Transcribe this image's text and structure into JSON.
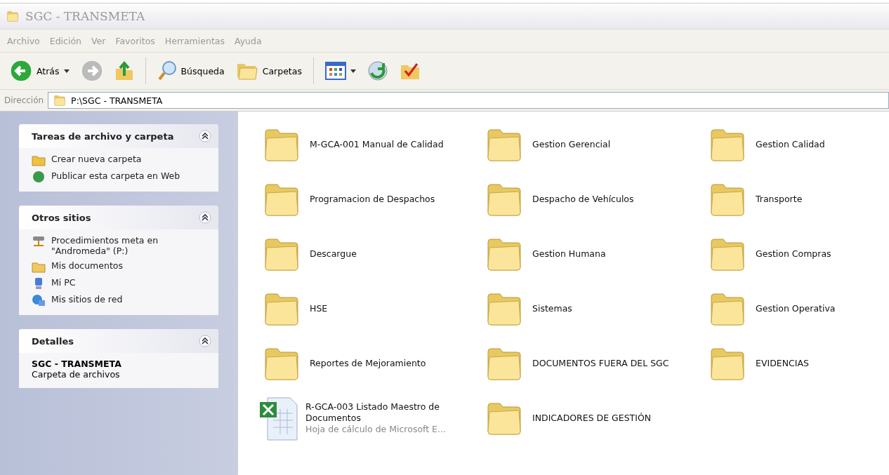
{
  "window": {
    "title": "SGC - TRANSMETA"
  },
  "menu": [
    "Archivo",
    "Edición",
    "Ver",
    "Favoritos",
    "Herramientas",
    "Ayuda"
  ],
  "toolbar": [
    {
      "kind": "back",
      "label": "Atrás"
    },
    {
      "kind": "forward"
    },
    {
      "kind": "up"
    },
    {
      "kind": "separator"
    },
    {
      "kind": "search",
      "label": "Búsqueda"
    },
    {
      "kind": "folders",
      "label": "Carpetas"
    },
    {
      "kind": "separator"
    },
    {
      "kind": "views"
    },
    {
      "kind": "sync"
    },
    {
      "kind": "check"
    }
  ],
  "address": {
    "label": "Dirección",
    "value": "P:\\SGC - TRANSMETA"
  },
  "panels": [
    {
      "title": "Tareas de archivo y carpeta",
      "expanded": true,
      "links": [
        {
          "kind": "newfolder",
          "label": "Crear nueva carpeta"
        },
        {
          "kind": "web",
          "label": "Publicar esta carpeta en Web"
        }
      ]
    },
    {
      "title": "Otros sitios",
      "expanded": true,
      "links": [
        {
          "kind": "drive",
          "label": "Procedimientos meta en \"Andromeda\" (P:)"
        },
        {
          "kind": "docs",
          "label": "Mis documentos"
        },
        {
          "kind": "pc",
          "label": "Mi PC"
        },
        {
          "kind": "network",
          "label": "Mis sitios de red"
        }
      ]
    },
    {
      "title": "Detalles",
      "expanded": true,
      "detail_name": "SGC - TRANSMETA",
      "detail_type": "Carpeta de archivos"
    }
  ],
  "items": [
    {
      "kind": "folder",
      "name": "M-GCA-001 Manual de Calidad"
    },
    {
      "kind": "folder",
      "name": "Gestion Gerencial"
    },
    {
      "kind": "folder",
      "name": "Gestion Calidad"
    },
    {
      "kind": "folder",
      "name": "Programacion de Despachos"
    },
    {
      "kind": "folder",
      "name": "Despacho de Vehículos"
    },
    {
      "kind": "folder",
      "name": "Transporte"
    },
    {
      "kind": "folder",
      "name": "Descargue"
    },
    {
      "kind": "folder",
      "name": "Gestion Humana"
    },
    {
      "kind": "folder",
      "name": "Gestion Compras"
    },
    {
      "kind": "folder",
      "name": "HSE"
    },
    {
      "kind": "folder",
      "name": "Sistemas"
    },
    {
      "kind": "folder",
      "name": "Gestion Operativa"
    },
    {
      "kind": "folder",
      "name": "Reportes de Mejoramiento"
    },
    {
      "kind": "folder",
      "name": "DOCUMENTOS FUERA DEL SGC"
    },
    {
      "kind": "folder",
      "name": "EVIDENCIAS"
    },
    {
      "kind": "spreadsheet",
      "name": "R-GCA-003 Listado Maestro de Documentos",
      "type": "Hoja de cálculo de Microsoft E..."
    },
    {
      "kind": "folder",
      "name": "INDICADORES DE GESTIÓN"
    }
  ]
}
